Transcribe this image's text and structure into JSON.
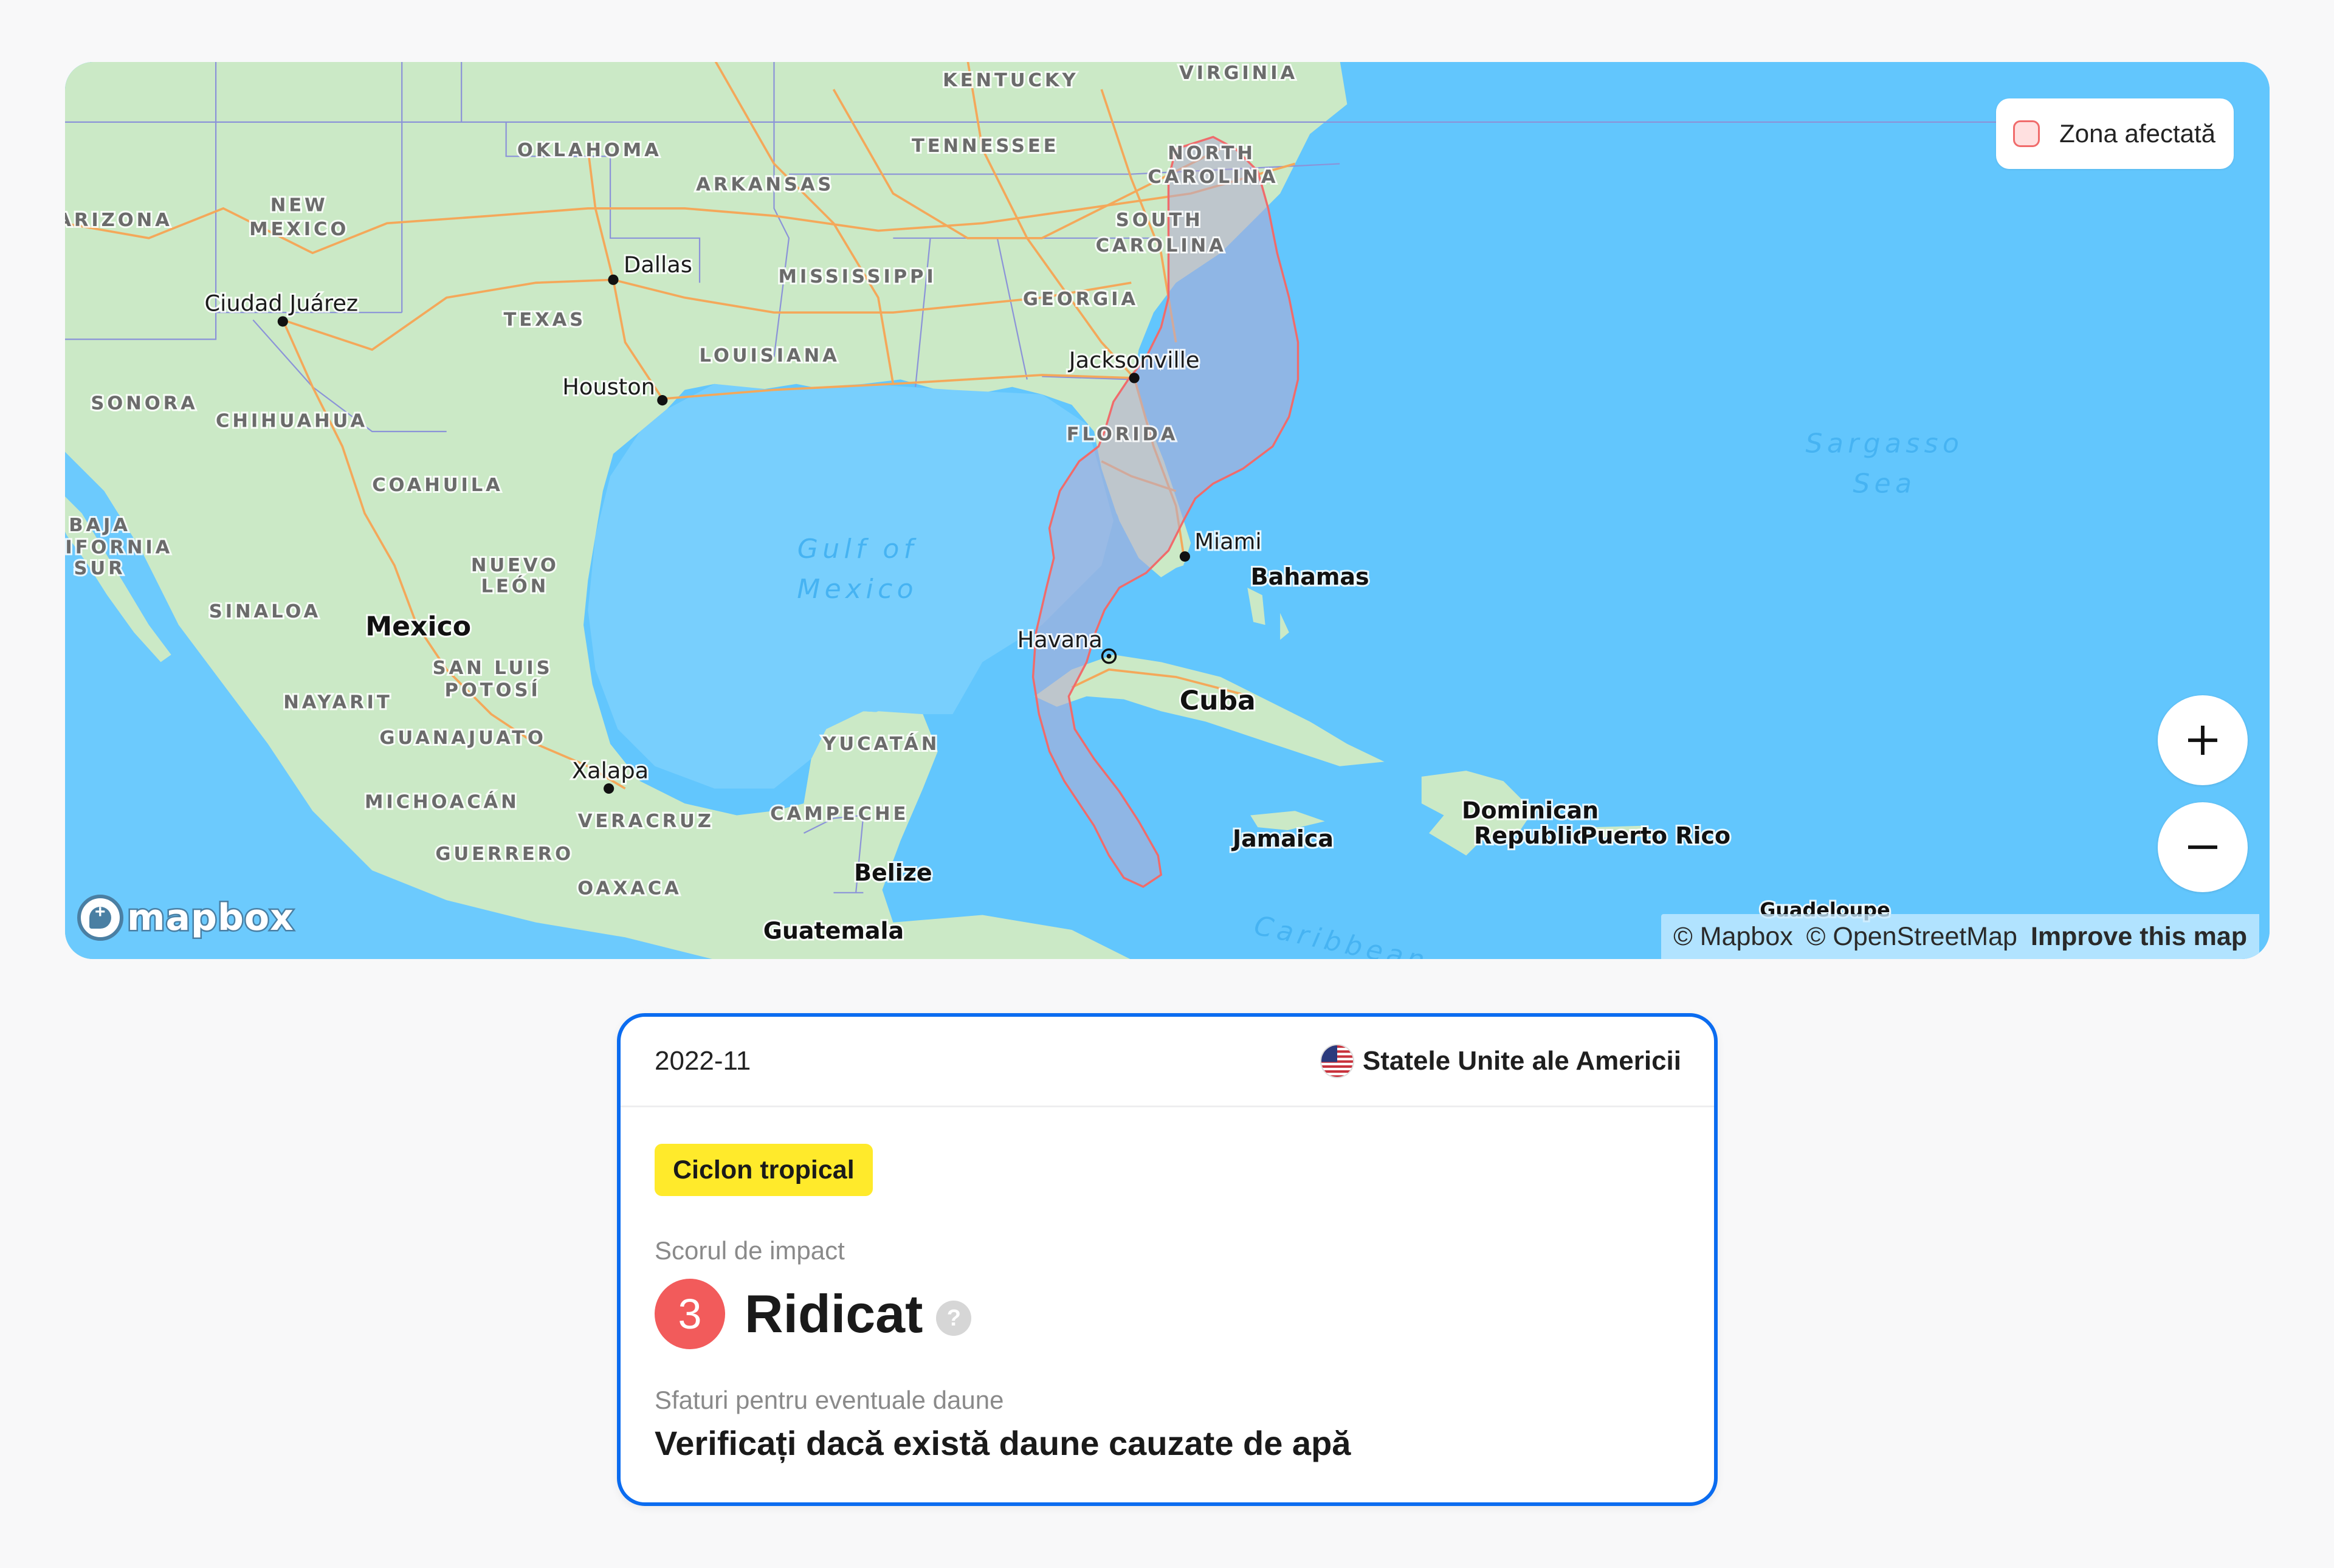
{
  "map": {
    "legend": {
      "label": "Zona afectată",
      "swatch_fill": "#ffe0e0",
      "swatch_border": "#f06b6b"
    },
    "zoom_in_icon": "plus-icon",
    "zoom_out_icon": "minus-icon",
    "logo_text": "mapbox",
    "attribution": {
      "mapbox": "© Mapbox",
      "osm": "© OpenStreetMap",
      "improve": "Improve this map"
    },
    "affected_zone_color": "#f06b6b",
    "labels": {
      "states": [
        "KENTUCKY",
        "VIRGINIA",
        "OKLAHOMA",
        "TENNESSEE",
        "ARKANSAS",
        "NORTH",
        "CAROLINA",
        "NEW",
        "MEXICO",
        "ARIZONA",
        "SOUTH",
        "CAROLINA",
        "MISSISSIPPI",
        "GEORGIA",
        "TEXAS",
        "LOUISIANA",
        "SONORA",
        "CHIHUAHUA",
        "FLORIDA",
        "COAHUILA",
        "BAJA",
        "LIFORNIA",
        "SUR",
        "NUEVO",
        "LEÓN",
        "SINALOA",
        "SAN LUIS",
        "POTOSÍ",
        "NAYARIT",
        "GUANAJUATO",
        "YUCATÁN",
        "MICHOACÁN",
        "VERACRUZ",
        "CAMPECHE",
        "GUERRERO",
        "OAXACA"
      ],
      "cities": [
        "Dallas",
        "Ciudad Juárez",
        "Houston",
        "Jacksonville",
        "Miami",
        "Havana",
        "Xalapa"
      ],
      "countries": [
        "Mexico",
        "Cuba",
        "Bahamas",
        "Jamaica",
        "Dominican",
        "Republic",
        "Puerto Rico",
        "Belize",
        "Guatemala",
        "Guadeloupe"
      ],
      "water": [
        "Gulf of",
        "Mexico",
        "Sargasso",
        "Sea",
        "Caribbean"
      ]
    }
  },
  "card": {
    "date": "2022-11",
    "country": "Statele Unite ale Americii",
    "country_flag_icon": "us-flag-icon",
    "event_type": "Ciclon tropical",
    "event_type_color": "#ffea2b",
    "impact_label": "Scorul de impact",
    "impact_score": "3",
    "impact_score_color": "#f25b5b",
    "impact_level": "Ridicat",
    "help_icon": "?",
    "advice_label": "Sfaturi pentru eventuale daune",
    "advice": "Verificați dacă există daune cauzate de apă",
    "border_color": "#0b6cf0"
  }
}
